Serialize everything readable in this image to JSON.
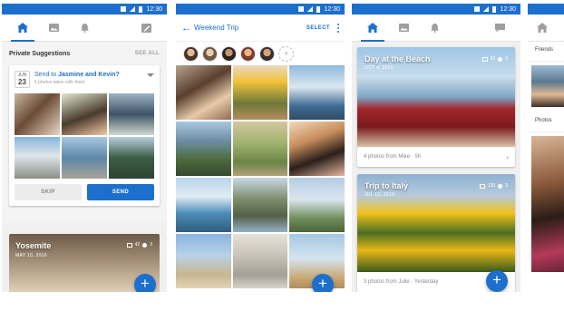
{
  "status": {
    "time": "12:30"
  },
  "phone1": {
    "section_title": "Private Suggestions",
    "see_all": "SEE ALL",
    "date_month": "JUN",
    "date_day": "23",
    "send_prefix": "Send to ",
    "send_names": "Jasmine and Kevin?",
    "send_sub": "6 photos taken with them",
    "skip_label": "SKIP",
    "send_label": "SEND",
    "album_title": "Yosemite",
    "album_date": "MAY 10, 2016",
    "album_photo_count": "42",
    "album_people_count": "3",
    "fab_label": "+"
  },
  "phone2": {
    "back_icon": "←",
    "title": "Weekend Trip",
    "select_label": "SELECT",
    "add_person": "+",
    "fab_label": "+"
  },
  "phone3": {
    "album1_title": "Day at the Beach",
    "album1_date": "OCT 4, 2015",
    "album1_photos": "62",
    "album1_people": "3",
    "album1_foot_count": "4 photos",
    "album1_foot_from": " from Mike · 5h",
    "album2_title": "Trip to Italy",
    "album2_date": "JUL 13, 2015",
    "album2_photos": "135",
    "album2_people": "3",
    "album2_foot_count": "3 photos",
    "album2_foot_from": " from Julie · Yesterday",
    "arrow": "›",
    "fab_label": "+"
  },
  "phone4": {
    "row1": "Friends",
    "row2": "Photos"
  },
  "colors": {
    "accent": "#1d6fcd"
  }
}
